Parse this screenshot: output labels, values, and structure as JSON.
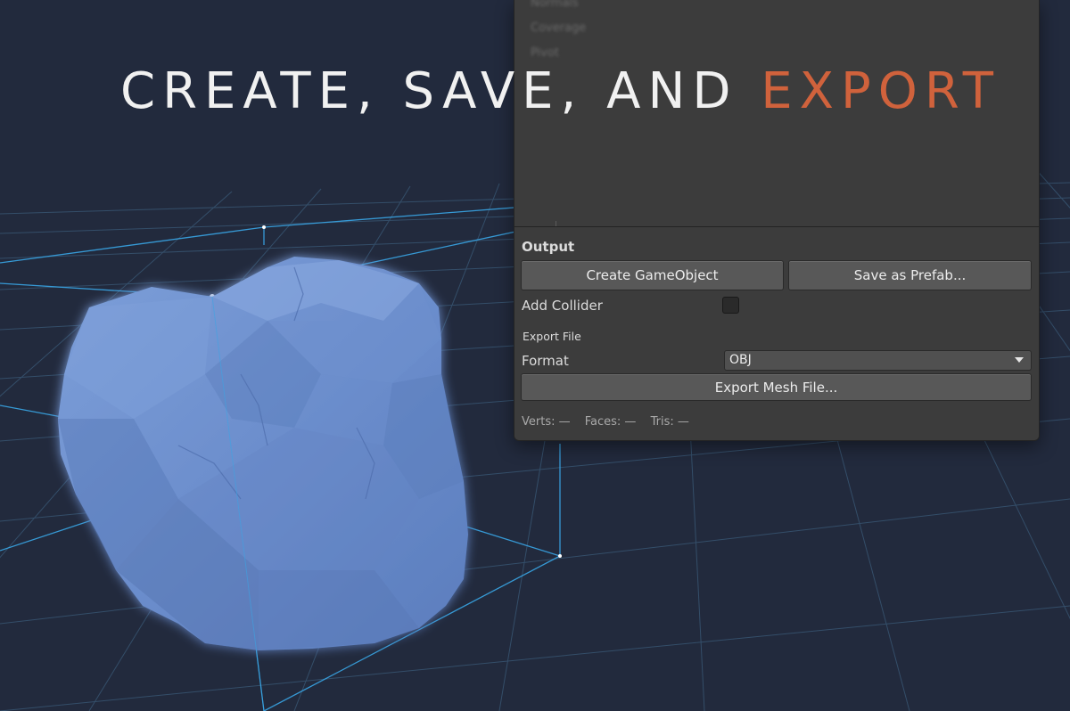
{
  "headline": {
    "part1": "CREATE, SAVE, AND ",
    "accent": "EXPORT"
  },
  "colors": {
    "accent": "#d0623c",
    "panel_bg": "#3c3c3c",
    "mesh": "#6f92cf",
    "grid": "#3f6f8f"
  },
  "panel": {
    "ghost_items": [
      "Normals",
      "Coverage",
      "Pivot"
    ],
    "output": {
      "heading": "Output",
      "create_label": "Create GameObject",
      "prefab_label": "Save as Prefab...",
      "collider_label": "Add Collider",
      "collider_checked": false
    },
    "export": {
      "heading": "Export File",
      "format_label": "Format",
      "format_value": "OBJ",
      "export_label": "Export Mesh File..."
    },
    "stats": {
      "verts": "Verts: —",
      "faces": "Faces: —",
      "tris": "Tris: —"
    }
  }
}
